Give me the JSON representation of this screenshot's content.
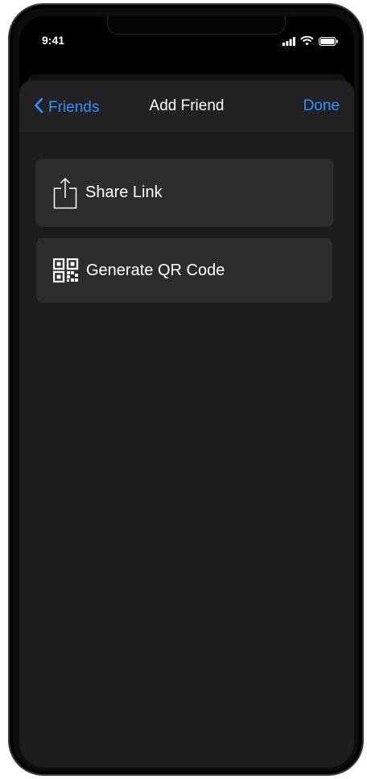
{
  "status_bar": {
    "time": "9:41",
    "icons": [
      "signal-icon",
      "wifi-icon",
      "battery-icon"
    ]
  },
  "nav": {
    "back_label": "Friends",
    "title": "Add Friend",
    "done_label": "Done"
  },
  "options": [
    {
      "label": "Share Link",
      "icon": "share-icon"
    },
    {
      "label": "Generate QR Code",
      "icon": "qr-code-icon"
    }
  ],
  "colors": {
    "accent": "#3a8dff",
    "background": "#1c1c1e",
    "card": "#2c2c2e",
    "text": "#ffffff"
  }
}
